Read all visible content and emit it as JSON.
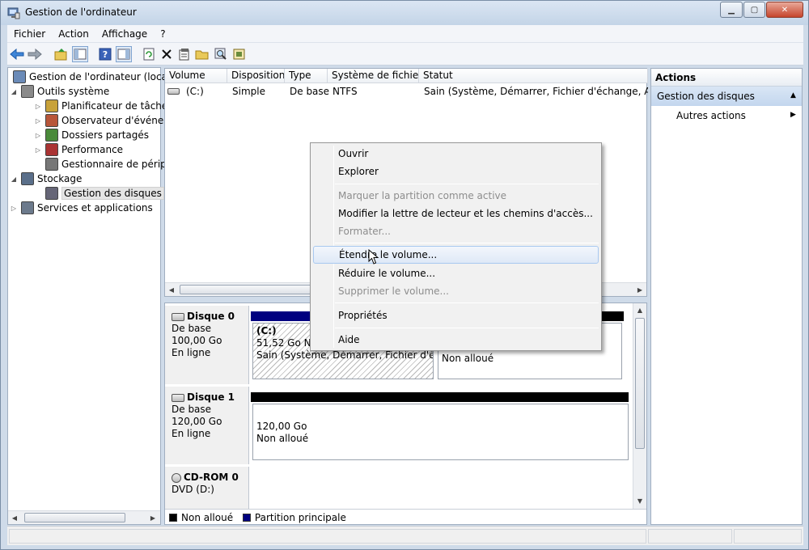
{
  "window": {
    "title": "Gestion de l'ordinateur"
  },
  "menu": [
    "Fichier",
    "Action",
    "Affichage",
    "?"
  ],
  "tree": [
    {
      "label": "Gestion de l'ordinateur (local)",
      "level": 0,
      "twisty": ""
    },
    {
      "label": "Outils système",
      "level": 1,
      "twisty": "expanded"
    },
    {
      "label": "Planificateur de tâches",
      "level": 2,
      "twisty": "collapsed"
    },
    {
      "label": "Observateur d'événeme",
      "level": 2,
      "twisty": "collapsed"
    },
    {
      "label": "Dossiers partagés",
      "level": 2,
      "twisty": "collapsed"
    },
    {
      "label": "Performance",
      "level": 2,
      "twisty": "collapsed"
    },
    {
      "label": "Gestionnaire de périphé",
      "level": 2,
      "twisty": ""
    },
    {
      "label": "Stockage",
      "level": 1,
      "twisty": "expanded"
    },
    {
      "label": "Gestion des disques",
      "level": 2,
      "twisty": "",
      "selected": true
    },
    {
      "label": "Services et applications",
      "level": 1,
      "twisty": "collapsed"
    }
  ],
  "volumes": {
    "columns": [
      "Volume",
      "Disposition",
      "Type",
      "Système de fichiers",
      "Statut"
    ],
    "rows": [
      [
        "(C:)",
        "Simple",
        "De base",
        "NTFS",
        "Sain (Système, Démarrer, Fichier d'échange, Actif, Vi"
      ]
    ]
  },
  "disks": [
    {
      "name": "Disque 0",
      "type": "De base",
      "size": "100,00 Go",
      "state": "En ligne"
    },
    {
      "name": "Disque 1",
      "type": "De base",
      "size": "120,00 Go",
      "state": "En ligne"
    },
    {
      "name": "CD-ROM 0",
      "type": "DVD (D:)"
    }
  ],
  "partitions": {
    "c_name": "(C:)",
    "c_size": "51,52 Go NTFS",
    "c_status": "Sain (Système, Démarrer, Fichier d'échange",
    "d0_unalloc": "Non alloué",
    "d1_size": "120,00 Go",
    "d1_unalloc": "Non alloué"
  },
  "legend": [
    "Non alloué",
    "Partition principale"
  ],
  "actions": {
    "header": "Actions",
    "selected": "Gestion des disques",
    "more": "Autres actions"
  },
  "context_menu": {
    "items": [
      {
        "label": "Ouvrir",
        "enabled": true
      },
      {
        "label": "Explorer",
        "enabled": true
      },
      {
        "label": "Marquer la partition comme active",
        "enabled": false
      },
      {
        "label": "Modifier la lettre de lecteur et les chemins d'accès...",
        "enabled": true
      },
      {
        "label": "Formater...",
        "enabled": false
      },
      {
        "label": "Étendre le volume...",
        "enabled": true,
        "hover": true
      },
      {
        "label": "Réduire le volume...",
        "enabled": true
      },
      {
        "label": "Supprimer le volume...",
        "enabled": false
      },
      {
        "label": "Propriétés",
        "enabled": true
      },
      {
        "label": "Aide",
        "enabled": true
      }
    ]
  },
  "colors": {
    "unallocated": "#000000",
    "primary_partition": "#000080",
    "selection": "#c3d6ee"
  },
  "icons": [
    "computer-icon",
    "back-icon",
    "forward-icon",
    "up-icon",
    "show-hide-tree-icon",
    "help-icon",
    "properties-icon",
    "refresh-icon",
    "delete-icon",
    "open-icon",
    "search-icon",
    "export-icon",
    "tools-icon",
    "clock-icon",
    "event-viewer-icon",
    "shared-folders-icon",
    "performance-icon",
    "device-manager-icon",
    "storage-icon",
    "disk-management-icon",
    "services-icon",
    "disk-icon",
    "cdrom-icon",
    "mouse-cursor-icon"
  ]
}
